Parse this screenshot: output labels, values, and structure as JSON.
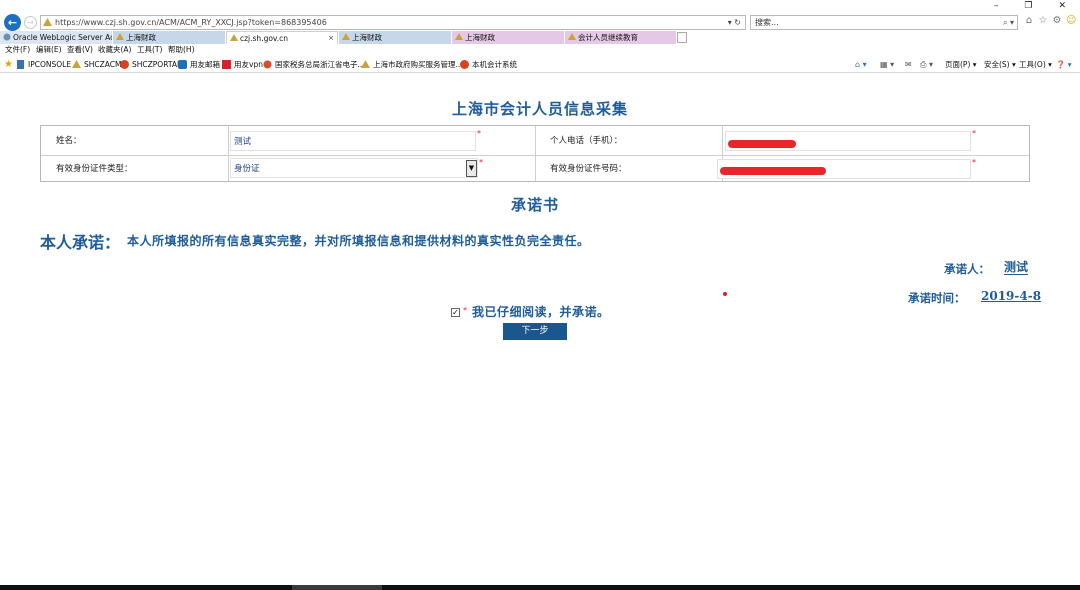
{
  "browser": {
    "window_controls": [
      "–",
      "❐",
      "✕"
    ],
    "address": "https://www.czj.sh.gov.cn/ACM/ACM_RY_XXCJ.jsp?token=868395406",
    "address_tools": "▾ ↻",
    "search_placeholder": "搜索...",
    "search_icon_glyph": "⌕ ▾",
    "tabs": [
      {
        "label": "Oracle WebLogic Server Ad..."
      },
      {
        "label": "上海财政"
      },
      {
        "label": "czj.sh.gov.cn",
        "close": "×"
      },
      {
        "label": "上海财政"
      },
      {
        "label": "上海财政"
      },
      {
        "label": "会计人员继续教育"
      }
    ],
    "menu": [
      "文件(F)",
      "编辑(E)",
      "查看(V)",
      "收藏夹(A)",
      "工具(T)",
      "帮助(H)"
    ],
    "favorites": [
      "IPCONSOLE",
      "SHCZACM",
      "SHCZPORTAL",
      "用友邮箱",
      "用友vpn",
      "国家税务总局浙江省电子...",
      "上海市政府购买服务管理...",
      "本机会计系统"
    ],
    "commands": [
      "页面(P) ▾",
      "安全(S) ▾",
      "工具(O) ▾",
      "❓ ▾"
    ]
  },
  "page": {
    "title": "上海市会计人员信息采集",
    "form": {
      "name_label": "姓名：",
      "name_value": "测试",
      "phone_label": "个人电话（手机）：",
      "id_type_label": "有效身份证件类型：",
      "id_type_value": "身份证",
      "id_number_label": "有效身份证件号码：",
      "required_mark": "*",
      "dropdown_glyph": "▼"
    },
    "pledge": {
      "title": "承诺书",
      "lead": "本人承诺：",
      "body": "本人所填报的所有信息真实完整，并对所填报信息和提供材料的真实性负完全责任。",
      "signer_label": "承诺人：",
      "signer_value": "测试",
      "date_label": "承诺时间：",
      "date_value": "2019-4-8",
      "checkbox_glyph": "✓",
      "agree_text": "我已仔细阅读，并承诺。",
      "next_button": "下一步"
    }
  },
  "colors": {
    "accent": "#1f5c9a",
    "button": "#19588f",
    "required": "#e02020",
    "redaction": "#e8262a"
  }
}
